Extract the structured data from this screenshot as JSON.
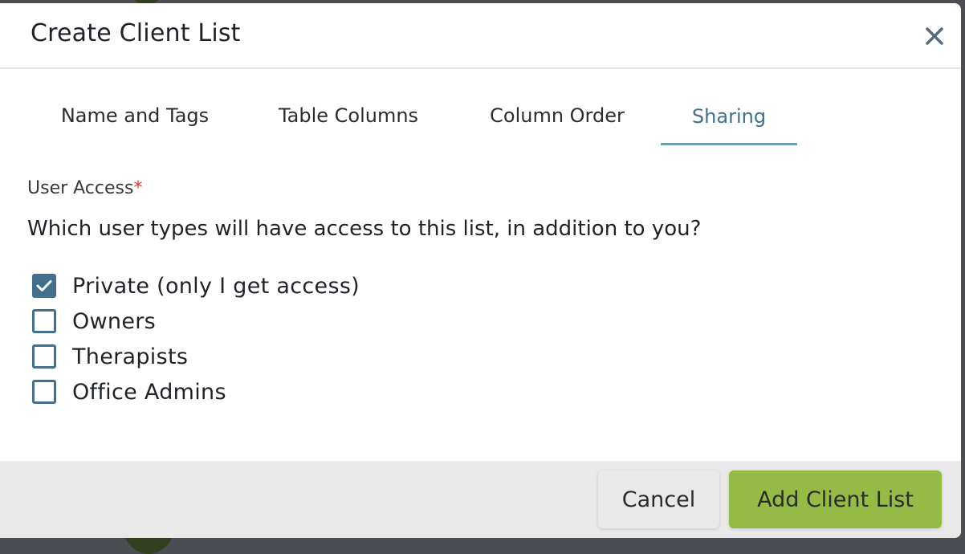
{
  "dialog": {
    "title": "Create Client List",
    "close_icon": "close-icon"
  },
  "tabs": [
    {
      "label": "Name and Tags",
      "active": false
    },
    {
      "label": "Table Columns",
      "active": false
    },
    {
      "label": "Column Order",
      "active": false
    },
    {
      "label": "Sharing",
      "active": true
    }
  ],
  "sharing": {
    "field_label": "User Access",
    "required_mark": "*",
    "question": "Which user types will have access to this list, in addition to you?",
    "options": [
      {
        "label": "Private (only I get access)",
        "checked": true
      },
      {
        "label": "Owners",
        "checked": false
      },
      {
        "label": "Therapists",
        "checked": false
      },
      {
        "label": "Office Admins",
        "checked": false
      }
    ]
  },
  "footer": {
    "cancel_label": "Cancel",
    "submit_label": "Add Client List"
  },
  "colors": {
    "accent": "#41708f",
    "tab_underline": "#6e9db9",
    "primary_button": "#93bb45",
    "required": "#d9372b"
  }
}
